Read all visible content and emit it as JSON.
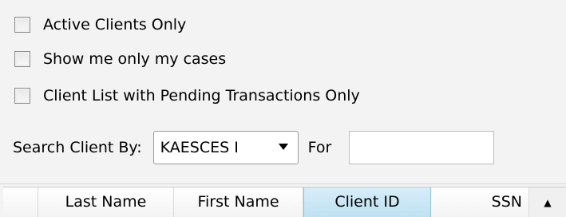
{
  "filters": {
    "active_clients_label": "Active Clients Only",
    "my_cases_label": "Show me only my cases",
    "pending_transactions_label": "Client List with Pending Transactions Only"
  },
  "search": {
    "label": "Search Client By:",
    "selected_option": "KAESCES I",
    "for_label": "For",
    "for_value": ""
  },
  "grid": {
    "columns": [
      "",
      "Last Name",
      "First Name",
      "Client ID",
      "SSN"
    ]
  },
  "icons": {
    "dropdown": "chevron-down-icon",
    "scroll_up": "scroll-up-icon"
  },
  "colors": {
    "panel_background": "#f3f3f3",
    "selected_column": "#cde8f6"
  }
}
